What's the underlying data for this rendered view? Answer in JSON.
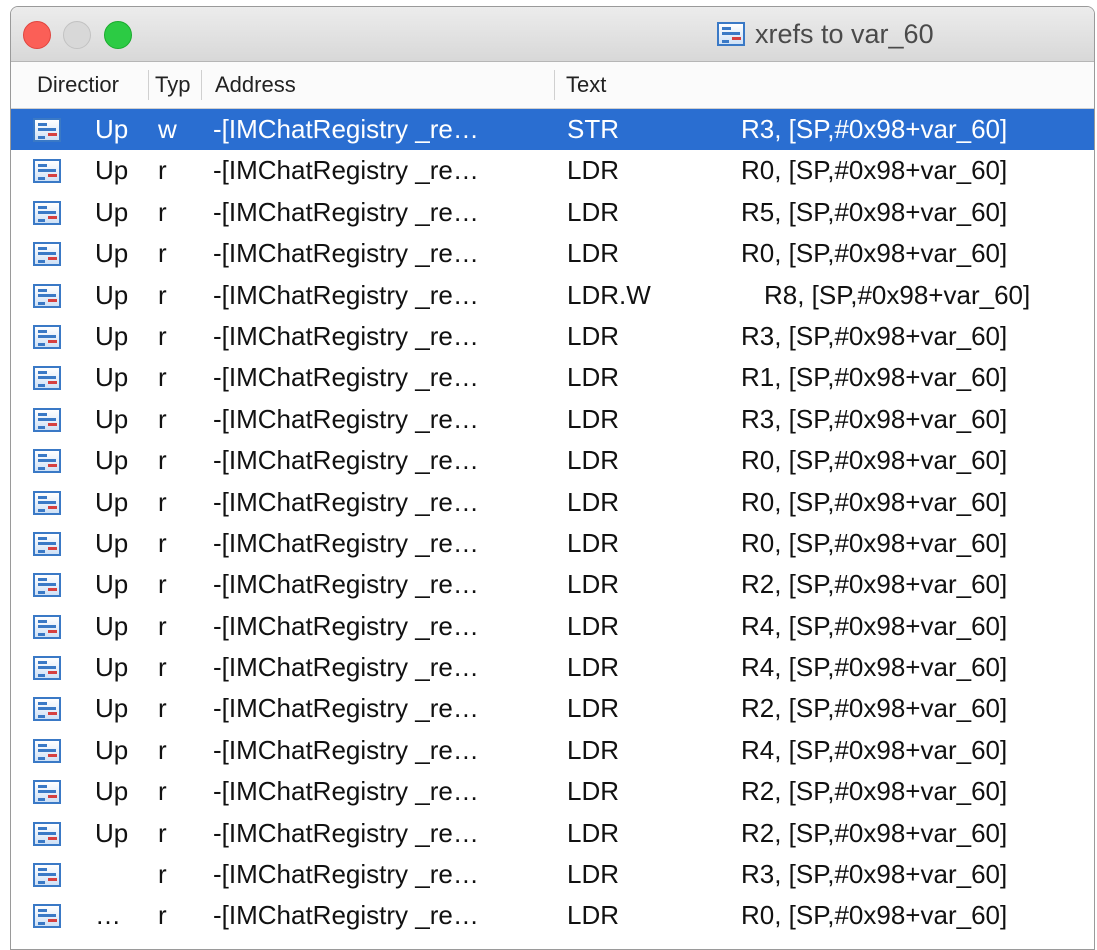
{
  "window": {
    "title": "xrefs to var_60",
    "title_icon": "xrefs-icon"
  },
  "columns": {
    "direction": "Directior",
    "type": "Typ",
    "address": "Address",
    "text": "Text"
  },
  "rows": [
    {
      "direction": "Up",
      "type": "w",
      "address": "-[IMChatRegistry _re…",
      "mnemonic": "STR",
      "operands": "R3, [SP,#0x98+var_60]"
    },
    {
      "direction": "Up",
      "type": "r",
      "address": "-[IMChatRegistry _re…",
      "mnemonic": "LDR",
      "operands": "R0, [SP,#0x98+var_60]"
    },
    {
      "direction": "Up",
      "type": "r",
      "address": "-[IMChatRegistry _re…",
      "mnemonic": "LDR",
      "operands": "R5, [SP,#0x98+var_60]"
    },
    {
      "direction": "Up",
      "type": "r",
      "address": "-[IMChatRegistry _re…",
      "mnemonic": "LDR",
      "operands": "R0, [SP,#0x98+var_60]"
    },
    {
      "direction": "Up",
      "type": "r",
      "address": "-[IMChatRegistry _re…",
      "mnemonic": "LDR.W",
      "operands": "R8, [SP,#0x98+var_60]"
    },
    {
      "direction": "Up",
      "type": "r",
      "address": "-[IMChatRegistry _re…",
      "mnemonic": "LDR",
      "operands": "R3, [SP,#0x98+var_60]"
    },
    {
      "direction": "Up",
      "type": "r",
      "address": "-[IMChatRegistry _re…",
      "mnemonic": "LDR",
      "operands": "R1, [SP,#0x98+var_60]"
    },
    {
      "direction": "Up",
      "type": "r",
      "address": "-[IMChatRegistry _re…",
      "mnemonic": "LDR",
      "operands": "R3, [SP,#0x98+var_60]"
    },
    {
      "direction": "Up",
      "type": "r",
      "address": "-[IMChatRegistry _re…",
      "mnemonic": "LDR",
      "operands": "R0, [SP,#0x98+var_60]"
    },
    {
      "direction": "Up",
      "type": "r",
      "address": "-[IMChatRegistry _re…",
      "mnemonic": "LDR",
      "operands": "R0, [SP,#0x98+var_60]"
    },
    {
      "direction": "Up",
      "type": "r",
      "address": "-[IMChatRegistry _re…",
      "mnemonic": "LDR",
      "operands": "R0, [SP,#0x98+var_60]"
    },
    {
      "direction": "Up",
      "type": "r",
      "address": "-[IMChatRegistry _re…",
      "mnemonic": "LDR",
      "operands": "R2, [SP,#0x98+var_60]"
    },
    {
      "direction": "Up",
      "type": "r",
      "address": "-[IMChatRegistry _re…",
      "mnemonic": "LDR",
      "operands": "R4, [SP,#0x98+var_60]"
    },
    {
      "direction": "Up",
      "type": "r",
      "address": "-[IMChatRegistry _re…",
      "mnemonic": "LDR",
      "operands": "R4, [SP,#0x98+var_60]"
    },
    {
      "direction": "Up",
      "type": "r",
      "address": "-[IMChatRegistry _re…",
      "mnemonic": "LDR",
      "operands": "R2, [SP,#0x98+var_60]"
    },
    {
      "direction": "Up",
      "type": "r",
      "address": "-[IMChatRegistry _re…",
      "mnemonic": "LDR",
      "operands": "R4, [SP,#0x98+var_60]"
    },
    {
      "direction": "Up",
      "type": "r",
      "address": "-[IMChatRegistry _re…",
      "mnemonic": "LDR",
      "operands": "R2, [SP,#0x98+var_60]"
    },
    {
      "direction": "Up",
      "type": "r",
      "address": "-[IMChatRegistry _re…",
      "mnemonic": "LDR",
      "operands": "R2, [SP,#0x98+var_60]"
    },
    {
      "direction": "",
      "type": "r",
      "address": "-[IMChatRegistry _re…",
      "mnemonic": "LDR",
      "operands": "R3, [SP,#0x98+var_60]"
    },
    {
      "direction": "…",
      "type": "r",
      "address": "-[IMChatRegistry _re…",
      "mnemonic": "LDR",
      "operands": "R0, [SP,#0x98+var_60]"
    }
  ],
  "selected_row": 0,
  "row_icon": "xref-row-icon",
  "colors": {
    "selection": "#2a6ed1",
    "icon_blue": "#3a79c6",
    "icon_red": "#d64040"
  }
}
